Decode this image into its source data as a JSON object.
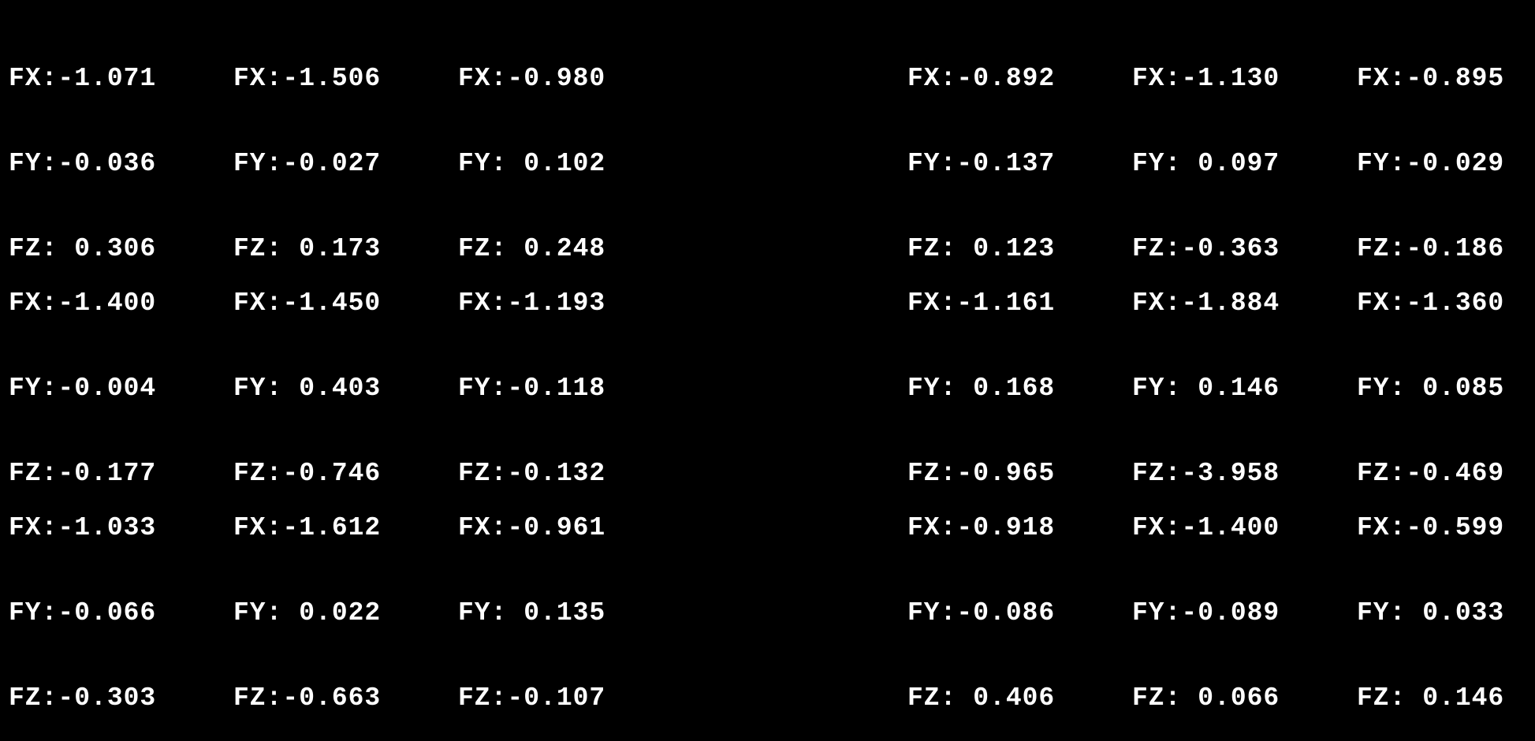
{
  "readouts": [
    {
      "fx": "FX:-1.071",
      "fy": "FY:-0.036",
      "fz": "FZ: 0.306"
    },
    {
      "fx": "FX:-1.506",
      "fy": "FY:-0.027",
      "fz": "FZ: 0.173"
    },
    {
      "fx": "FX:-0.980",
      "fy": "FY: 0.102",
      "fz": "FZ: 0.248"
    },
    {
      "fx": "FX:-0.892",
      "fy": "FY:-0.137",
      "fz": "FZ: 0.123"
    },
    {
      "fx": "FX:-1.130",
      "fy": "FY: 0.097",
      "fz": "FZ:-0.363"
    },
    {
      "fx": "FX:-0.895",
      "fy": "FY:-0.029",
      "fz": "FZ:-0.186"
    },
    {
      "fx": "FX:-1.400",
      "fy": "FY:-0.004",
      "fz": "FZ:-0.177"
    },
    {
      "fx": "FX:-1.450",
      "fy": "FY: 0.403",
      "fz": "FZ:-0.746"
    },
    {
      "fx": "FX:-1.193",
      "fy": "FY:-0.118",
      "fz": "FZ:-0.132"
    },
    {
      "fx": "FX:-1.161",
      "fy": "FY: 0.168",
      "fz": "FZ:-0.965"
    },
    {
      "fx": "FX:-1.884",
      "fy": "FY: 0.146",
      "fz": "FZ:-3.958"
    },
    {
      "fx": "FX:-1.360",
      "fy": "FY: 0.085",
      "fz": "FZ:-0.469"
    },
    {
      "fx": "FX:-1.033",
      "fy": "FY:-0.066",
      "fz": "FZ:-0.303"
    },
    {
      "fx": "FX:-1.612",
      "fy": "FY: 0.022",
      "fz": "FZ:-0.663"
    },
    {
      "fx": "FX:-0.961",
      "fy": "FY: 0.135",
      "fz": "FZ:-0.107"
    },
    {
      "fx": "FX:-0.918",
      "fy": "FY:-0.086",
      "fz": "FZ: 0.406"
    },
    {
      "fx": "FX:-1.400",
      "fy": "FY:-0.089",
      "fz": "FZ: 0.066"
    },
    {
      "fx": "FX:-0.599",
      "fy": "FY: 0.033",
      "fz": "FZ: 0.146"
    }
  ]
}
